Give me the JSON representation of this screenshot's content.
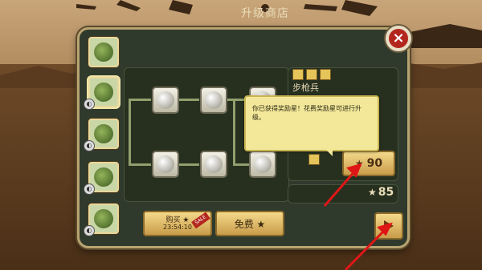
{
  "shop": {
    "title": "升级商店",
    "unit_name": "步枪兵",
    "tooltip": "你已获得奖励星！花费奖励星可进行升级。",
    "cost": "90",
    "stars_balance": "85",
    "button_left_top": "购买 ★",
    "button_left_bottom": "23:54:10",
    "button_left_ribbon": "SALE",
    "button_right": "免费 ★"
  },
  "icons": {
    "close": "close-icon",
    "next": "arrow-right-icon",
    "star": "star-icon",
    "lock": "lock-icon"
  },
  "colors": {
    "panel": "#2f3a2c",
    "gold": "#f3d98a",
    "tooltip": "#f3e89a",
    "annotation": "#e01616"
  }
}
